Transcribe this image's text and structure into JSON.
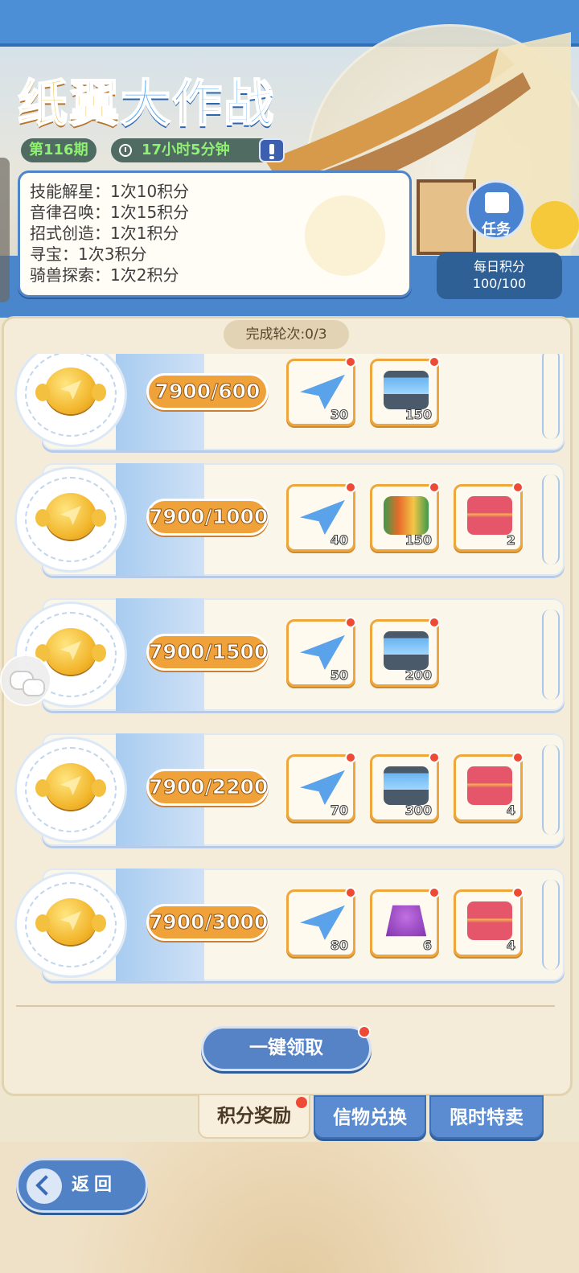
{
  "header": {
    "title_part1": "纸翼",
    "title_part2": "大作战",
    "issue": "第116期",
    "countdown": "17小时5分钟"
  },
  "rules": [
    "技能解星：1次10积分",
    "音律召唤：1次15积分",
    "招式创造：1次1积分",
    "寻宝：1次3积分",
    "骑兽探索：1次2积分"
  ],
  "task_button": {
    "label": "任务"
  },
  "daily_points": {
    "label": "每日积分",
    "value": "100/100"
  },
  "rounds": "完成轮次:0/3",
  "rewards": [
    {
      "progress": "7900/600",
      "items": [
        {
          "icon": "paper-plane",
          "count": "30"
        },
        {
          "icon": "energy-canister",
          "count": "150"
        }
      ]
    },
    {
      "progress": "7900/1000",
      "items": [
        {
          "icon": "paper-plane",
          "count": "40"
        },
        {
          "icon": "capybara-scroll",
          "count": "150"
        },
        {
          "icon": "treasure-chest",
          "count": "2"
        }
      ]
    },
    {
      "progress": "7900/1500",
      "items": [
        {
          "icon": "paper-plane",
          "count": "50"
        },
        {
          "icon": "energy-canister",
          "count": "200"
        }
      ]
    },
    {
      "progress": "7900/2200",
      "items": [
        {
          "icon": "paper-plane",
          "count": "70"
        },
        {
          "icon": "energy-canister",
          "count": "300"
        },
        {
          "icon": "treasure-chest",
          "count": "4"
        }
      ]
    },
    {
      "progress": "7900/3000",
      "items": [
        {
          "icon": "paper-plane",
          "count": "80"
        },
        {
          "icon": "purple-bell",
          "count": "6"
        },
        {
          "icon": "treasure-chest",
          "count": "4"
        }
      ]
    }
  ],
  "claim_all": "一键领取",
  "tabs": [
    {
      "label": "积分奖励",
      "active": true
    },
    {
      "label": "信物兑换",
      "active": false
    },
    {
      "label": "限时特卖",
      "active": false
    }
  ],
  "back": "返回",
  "colors": {
    "accent_blue": "#4d8fd6",
    "accent_orange": "#f0a23a",
    "badge_red": "#ee4b37",
    "timer_green": "#8ff072"
  }
}
